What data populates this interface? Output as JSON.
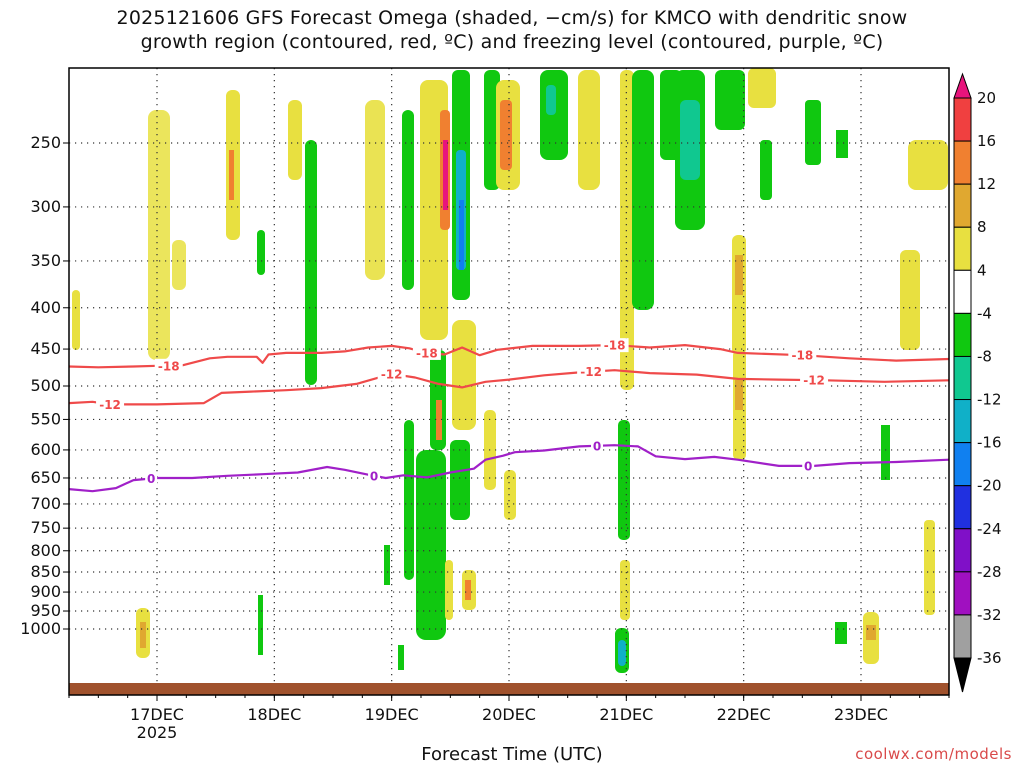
{
  "chart_data": {
    "type": "heatmap",
    "title_lines": [
      "2025121606 GFS Forecast Omega (shaded, −cm/s) for KMCO with dendritic snow",
      "growth region (contoured, red, ºC) and freezing level (contoured, purple, ºC)"
    ],
    "xlabel": "Forecast Time (UTC)",
    "y_ticks": [
      250,
      300,
      350,
      400,
      450,
      500,
      550,
      600,
      650,
      700,
      750,
      800,
      850,
      900,
      950,
      1000
    ],
    "y_range": [
      200,
      1025
    ],
    "x_ticks": [
      {
        "day": 17,
        "label": "17DEC",
        "sublabel": "2025"
      },
      {
        "day": 18,
        "label": "18DEC"
      },
      {
        "day": 19,
        "label": "19DEC"
      },
      {
        "day": 20,
        "label": "20DEC"
      },
      {
        "day": 21,
        "label": "21DEC"
      },
      {
        "day": 22,
        "label": "22DEC"
      },
      {
        "day": 23,
        "label": "23DEC"
      }
    ],
    "x_range_days": [
      16.25,
      23.75
    ],
    "colorbar": {
      "labels": [
        "20",
        "16",
        "12",
        "8",
        "4",
        "-4",
        "-8",
        "-12",
        "-16",
        "-20",
        "-24",
        "-28",
        "-32",
        "-36"
      ],
      "colors": [
        "#e8147c",
        "#f04040",
        "#f08030",
        "#e0a830",
        "#e8e040",
        "#ffffff",
        "#10c810",
        "#10c890",
        "#10b0c8",
        "#1080f0",
        "#2030e0",
        "#8010c8",
        "#a010c0",
        "#a0a0a0",
        "#000000"
      ]
    },
    "contours": [
      {
        "label": "-18",
        "color": "#ef4a4a",
        "points": [
          [
            16.25,
            473
          ],
          [
            16.5,
            474
          ],
          [
            16.8,
            473
          ],
          [
            17.0,
            472
          ],
          [
            17.2,
            472
          ],
          [
            17.45,
            462
          ],
          [
            17.6,
            460
          ],
          [
            17.85,
            460
          ],
          [
            17.9,
            468
          ],
          [
            17.95,
            457
          ],
          [
            18.1,
            455
          ],
          [
            18.4,
            455
          ],
          [
            18.6,
            453
          ],
          [
            18.8,
            448
          ],
          [
            19.0,
            446
          ],
          [
            19.15,
            449
          ],
          [
            19.3,
            455
          ],
          [
            19.45,
            457
          ],
          [
            19.6,
            448
          ],
          [
            19.75,
            458
          ],
          [
            19.9,
            451
          ],
          [
            20.2,
            446
          ],
          [
            20.6,
            446
          ],
          [
            20.9,
            445
          ],
          [
            21.2,
            448
          ],
          [
            21.5,
            445
          ],
          [
            21.8,
            450
          ],
          [
            21.95,
            455
          ],
          [
            22.5,
            458
          ],
          [
            22.9,
            462
          ],
          [
            23.3,
            465
          ],
          [
            23.75,
            463
          ]
        ],
        "label_days": [
          17.1,
          19.3,
          20.9,
          22.5
        ]
      },
      {
        "label": "-12",
        "color": "#ef4a4a",
        "points": [
          [
            16.25,
            525
          ],
          [
            16.45,
            523
          ],
          [
            16.6,
            527
          ],
          [
            17.0,
            527
          ],
          [
            17.4,
            525
          ],
          [
            17.55,
            510
          ],
          [
            17.8,
            508
          ],
          [
            18.1,
            506
          ],
          [
            18.4,
            503
          ],
          [
            18.7,
            497
          ],
          [
            19.0,
            483
          ],
          [
            19.2,
            488
          ],
          [
            19.4,
            497
          ],
          [
            19.6,
            502
          ],
          [
            19.8,
            494
          ],
          [
            20.0,
            491
          ],
          [
            20.3,
            485
          ],
          [
            20.6,
            481
          ],
          [
            20.9,
            478
          ],
          [
            21.2,
            482
          ],
          [
            21.6,
            484
          ],
          [
            21.95,
            490
          ],
          [
            22.3,
            491
          ],
          [
            22.7,
            492
          ],
          [
            23.2,
            494
          ],
          [
            23.75,
            492
          ]
        ],
        "label_days": [
          16.6,
          19.0,
          20.7,
          22.6
        ]
      },
      {
        "label": "0",
        "color": "#a020c8",
        "points": [
          [
            16.25,
            671
          ],
          [
            16.45,
            675
          ],
          [
            16.65,
            669
          ],
          [
            16.8,
            654
          ],
          [
            17.0,
            650
          ],
          [
            17.3,
            650
          ],
          [
            17.6,
            646
          ],
          [
            17.9,
            643
          ],
          [
            18.2,
            640
          ],
          [
            18.45,
            630
          ],
          [
            18.6,
            635
          ],
          [
            18.8,
            644
          ],
          [
            18.95,
            650
          ],
          [
            19.1,
            645
          ],
          [
            19.3,
            649
          ],
          [
            19.5,
            640
          ],
          [
            19.7,
            633
          ],
          [
            19.8,
            617
          ],
          [
            19.95,
            610
          ],
          [
            20.05,
            604
          ],
          [
            20.3,
            601
          ],
          [
            20.6,
            594
          ],
          [
            20.9,
            592
          ],
          [
            21.1,
            594
          ],
          [
            21.25,
            611
          ],
          [
            21.5,
            616
          ],
          [
            21.75,
            612
          ],
          [
            21.95,
            617
          ],
          [
            22.3,
            628
          ],
          [
            22.6,
            628
          ],
          [
            22.9,
            623
          ],
          [
            23.3,
            621
          ],
          [
            23.75,
            617
          ]
        ],
        "label_days": [
          16.95,
          18.85,
          20.75,
          22.55
        ]
      }
    ]
  },
  "footer": {
    "credit": "coolwx.com/models"
  }
}
